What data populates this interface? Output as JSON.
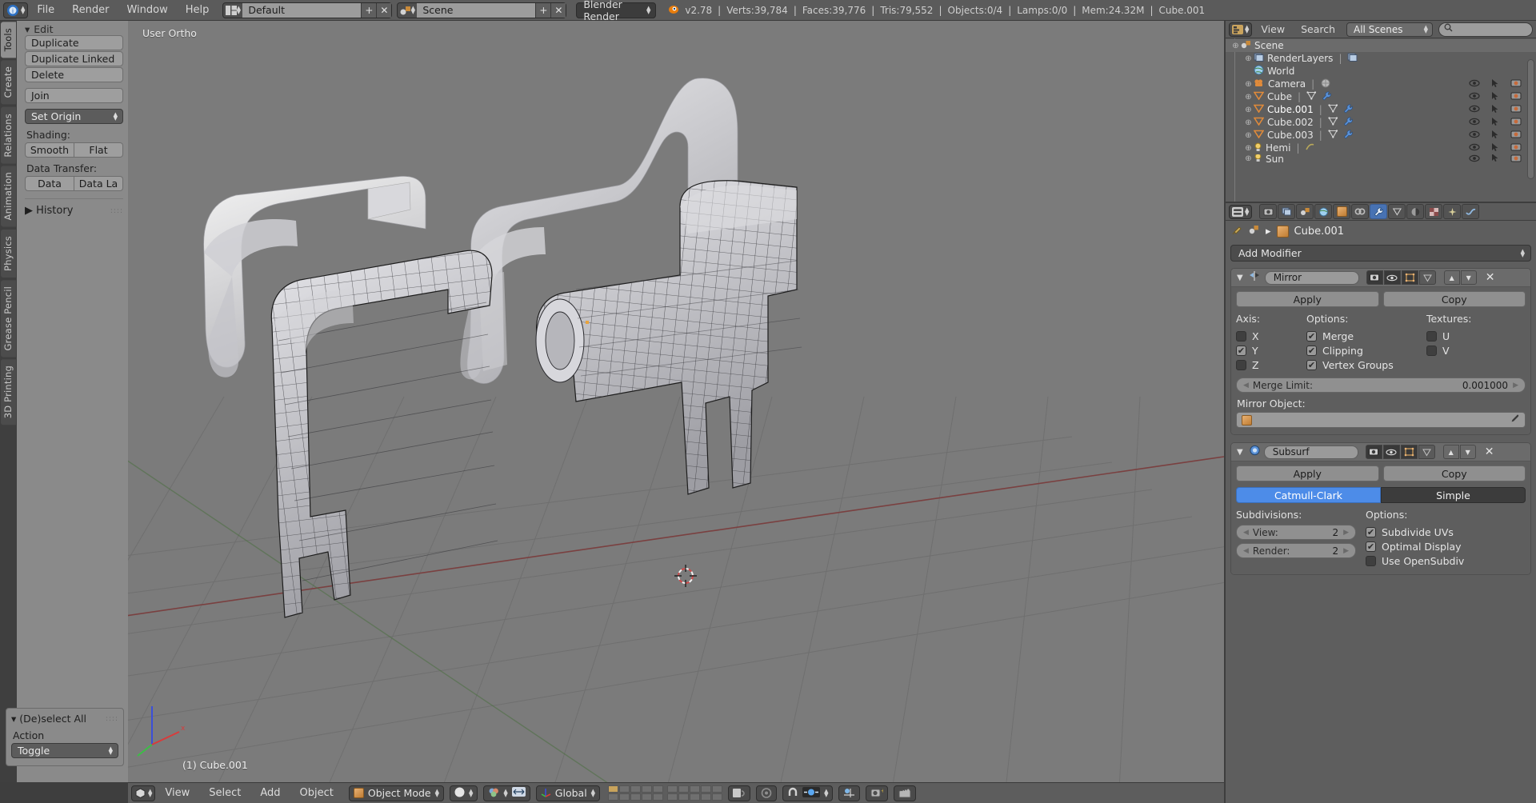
{
  "topbar": {
    "app_icon": "blender-logo-icon",
    "menus": [
      "File",
      "Render",
      "Window",
      "Help"
    ],
    "screen_layout": {
      "icon": "screen-layout-icon",
      "value": "Default",
      "add_label": "+",
      "remove_label": "✕"
    },
    "scene_select": {
      "icon": "scene-icon",
      "value": "Scene",
      "add_label": "+",
      "remove_label": "✕"
    },
    "render_engine": "Blender Render",
    "stats": {
      "version": "v2.78",
      "verts": "Verts:39,784",
      "faces": "Faces:39,776",
      "tris": "Tris:79,552",
      "objects": "Objects:0/4",
      "lamps": "Lamps:0/0",
      "mem": "Mem:24.32M",
      "active_object": "Cube.001"
    }
  },
  "toolshelf": {
    "tabs": [
      {
        "label": "Tools",
        "active": true
      },
      {
        "label": "Create",
        "active": false
      },
      {
        "label": "Relations",
        "active": false
      },
      {
        "label": "Animation",
        "active": false
      },
      {
        "label": "Physics",
        "active": false
      },
      {
        "label": "Grease Pencil",
        "active": false
      },
      {
        "label": "3D Printing",
        "active": false
      }
    ],
    "edit_header": "Edit",
    "buttons": [
      "Duplicate",
      "Duplicate Linked",
      "Delete"
    ],
    "join_label": "Join",
    "set_origin_label": "Set Origin",
    "shading_label": "Shading:",
    "shading_buttons": [
      "Smooth",
      "Flat"
    ],
    "data_transfer_label": "Data Transfer:",
    "data_transfer_buttons": [
      "Data",
      "Data La"
    ],
    "history_label": "History"
  },
  "operator_panel": {
    "title": "(De)select All",
    "action_label": "Action",
    "action_value": "Toggle"
  },
  "viewport": {
    "view_label": "User Ortho",
    "active_object_label": "(1) Cube.001",
    "background_color": "#7b7b7b",
    "grid_color": "#6d6d6d",
    "axis_x_color": "#bb3f3f",
    "axis_y_color": "#4f8f3f"
  },
  "viewport_header": {
    "editor_icon": "editor-type-3dview-icon",
    "menus": [
      "View",
      "Select",
      "Add",
      "Object"
    ],
    "mode": "Object Mode",
    "viewport_shading": "solid-shading-icon",
    "pivot": "pivot-icon",
    "manipulator": "manipulator-icon",
    "transform_orientation": "Global",
    "snap_icon": "magnet-icon",
    "proportional_icon": "proportional-edit-icon",
    "render_icon": "render-camera-icon",
    "animation_icon": "render-animation-icon"
  },
  "outliner": {
    "editor_icon": "editor-type-outliner-icon",
    "menus": [
      "View",
      "Search"
    ],
    "display_mode": "All Scenes",
    "search_placeholder": "",
    "search_icon": "search-icon",
    "rows": [
      {
        "indent": 0,
        "expand": "⊕",
        "icon": "scene-icon",
        "label": "Scene",
        "selected": true,
        "restrict": false
      },
      {
        "indent": 1,
        "expand": "⊕",
        "icon": "renderlayers-icon",
        "label": "RenderLayers",
        "selected": false,
        "restrict": false,
        "extra": "renderlayer-icon"
      },
      {
        "indent": 1,
        "expand": "",
        "icon": "world-icon",
        "label": "World",
        "selected": false,
        "restrict": false
      },
      {
        "indent": 1,
        "expand": "⊕",
        "icon": "camera-icon",
        "label": "Camera",
        "selected": false,
        "restrict": true,
        "extra": "camera-data-icon"
      },
      {
        "indent": 1,
        "expand": "⊕",
        "icon": "mesh-icon",
        "label": "Cube",
        "selected": false,
        "restrict": true,
        "extra": "mesh-data-icon",
        "extra2": "modifier-wrench-icon"
      },
      {
        "indent": 1,
        "expand": "⊕",
        "icon": "mesh-icon",
        "label": "Cube.001",
        "selected": true,
        "restrict": true,
        "extra": "mesh-data-icon",
        "extra2": "modifier-wrench-icon"
      },
      {
        "indent": 1,
        "expand": "⊕",
        "icon": "mesh-icon",
        "label": "Cube.002",
        "selected": false,
        "restrict": true,
        "extra": "mesh-data-icon",
        "extra2": "modifier-wrench-icon"
      },
      {
        "indent": 1,
        "expand": "⊕",
        "icon": "mesh-icon",
        "label": "Cube.003",
        "selected": false,
        "restrict": true,
        "extra": "mesh-data-icon",
        "extra2": "modifier-wrench-icon"
      },
      {
        "indent": 1,
        "expand": "⊕",
        "icon": "lamp-icon",
        "label": "Hemi",
        "selected": false,
        "restrict": true,
        "extra": "lamp-data-icon"
      },
      {
        "indent": 1,
        "expand": "⊕",
        "icon": "lamp-icon",
        "label": "Sun",
        "selected": false,
        "restrict": true,
        "extra": "lamp-data-icon"
      }
    ]
  },
  "properties": {
    "editor_icon": "editor-type-properties-icon",
    "tabs": [
      {
        "name": "render-tab",
        "glyph": "📷",
        "active": false
      },
      {
        "name": "renderlayers-tab",
        "glyph": "❐",
        "active": false
      },
      {
        "name": "scene-tab",
        "glyph": "◐",
        "active": false
      },
      {
        "name": "world-tab",
        "glyph": "●",
        "active": false
      },
      {
        "name": "object-tab",
        "glyph": "■",
        "active": false
      },
      {
        "name": "constraints-tab",
        "glyph": "⚭",
        "active": false
      },
      {
        "name": "modifiers-tab",
        "glyph": "🔧",
        "active": true
      },
      {
        "name": "data-tab",
        "glyph": "▽",
        "active": false
      },
      {
        "name": "material-tab",
        "glyph": "◑",
        "active": false
      },
      {
        "name": "texture-tab",
        "glyph": "▦",
        "active": false
      },
      {
        "name": "particles-tab",
        "glyph": "✸",
        "active": false
      },
      {
        "name": "physics-tab",
        "glyph": "⤵",
        "active": false
      }
    ],
    "breadcrumb": {
      "pin_icon": "pin-icon",
      "scene_icon": "scene-icon",
      "sep": "▸",
      "object_icon": "object-cube-icon",
      "object_name": "Cube.001"
    },
    "add_modifier_label": "Add Modifier",
    "modifiers": [
      {
        "name": "Mirror",
        "icon": "mirror-modifier-icon",
        "apply_label": "Apply",
        "copy_label": "Copy",
        "axis_title": "Axis:",
        "axis": [
          {
            "label": "X",
            "checked": false
          },
          {
            "label": "Y",
            "checked": true
          },
          {
            "label": "Z",
            "checked": false
          }
        ],
        "options_title": "Options:",
        "options": [
          {
            "label": "Merge",
            "checked": true
          },
          {
            "label": "Clipping",
            "checked": true
          },
          {
            "label": "Vertex Groups",
            "checked": true
          }
        ],
        "textures_title": "Textures:",
        "textures": [
          {
            "label": "U",
            "checked": false
          },
          {
            "label": "V",
            "checked": false
          }
        ],
        "merge_limit_label": "Merge Limit:",
        "merge_limit_value": "0.001000",
        "mirror_object_label": "Mirror Object:",
        "mirror_object_value": "",
        "eyedropper_icon": "eyedropper-icon"
      },
      {
        "name": "Subsurf",
        "icon": "subsurf-modifier-icon",
        "apply_label": "Apply",
        "copy_label": "Copy",
        "modes": [
          {
            "label": "Catmull-Clark",
            "active": true
          },
          {
            "label": "Simple",
            "active": false
          }
        ],
        "subdivisions_title": "Subdivisions:",
        "subdivisions": [
          {
            "label": "View:",
            "value": "2"
          },
          {
            "label": "Render:",
            "value": "2"
          }
        ],
        "options_title": "Options:",
        "options": [
          {
            "label": "Subdivide UVs",
            "checked": true
          },
          {
            "label": "Optimal Display",
            "checked": true
          },
          {
            "label": "Use OpenSubdiv",
            "checked": false
          }
        ]
      }
    ]
  },
  "colors": {
    "accent_blue": "#4d8ce8",
    "panel_bg": "#5e5e5e",
    "header_bg": "#5b5b5b",
    "toolshelf_bg": "#8a8a8a",
    "viewport_bg": "#7b7b7b",
    "button_light": "#9a9a9a"
  }
}
